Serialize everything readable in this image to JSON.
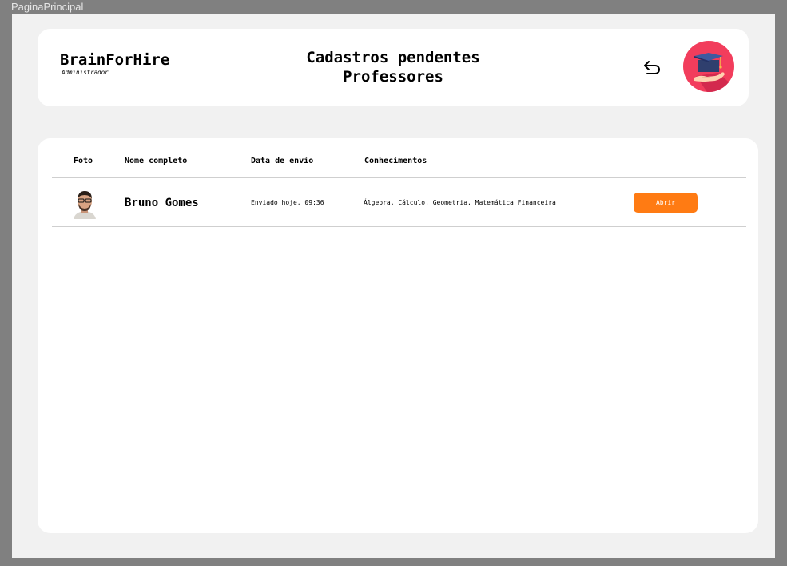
{
  "window": {
    "frame_label": "PaginaPrincipal"
  },
  "header": {
    "brand": "BrainForHire",
    "role": "Administrador",
    "title_line1": "Cadastros pendentes",
    "title_line2": "Professores",
    "back_icon": "undo-arrow-icon",
    "logo_icon": "graduation-cap-hand-icon",
    "logo_color": "#f23d5c"
  },
  "table": {
    "columns": {
      "photo": "Foto",
      "name": "Nome completo",
      "date": "Data de envio",
      "skills": "Conhecimentos"
    },
    "rows": [
      {
        "name": "Bruno Gomes",
        "date": "Enviado hoje, 09:36",
        "skills": "Álgebra, Cálculo, Geometria, Matemática Financeira",
        "action": "Abrir"
      }
    ]
  },
  "colors": {
    "accent": "#ff7b13",
    "background": "#f1f1f1",
    "card": "#ffffff"
  }
}
